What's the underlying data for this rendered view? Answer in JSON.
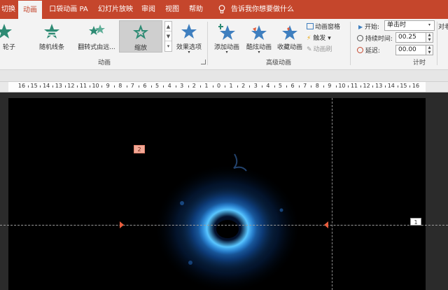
{
  "tabs": [
    {
      "label": "切换",
      "active": false
    },
    {
      "label": "动画",
      "active": true
    },
    {
      "label": "口袋动画 PA",
      "active": false
    },
    {
      "label": "幻灯片放映",
      "active": false
    },
    {
      "label": "审阅",
      "active": false
    },
    {
      "label": "视图",
      "active": false
    },
    {
      "label": "帮助",
      "active": false
    }
  ],
  "tell_me": "告诉我你想要做什么",
  "animation_gallery": [
    {
      "label": "轮子",
      "icon": "star-wheel-icon",
      "selected": false
    },
    {
      "label": "随机线条",
      "icon": "star-random-lines-icon",
      "selected": false
    },
    {
      "label": "翻转式由远...",
      "icon": "star-flip-icon",
      "selected": false
    },
    {
      "label": "缩放",
      "icon": "star-zoom-icon",
      "selected": true
    }
  ],
  "effect_options": "效果选项",
  "group_labels": {
    "animation": "动画",
    "advanced": "高级动画",
    "timing": "计时"
  },
  "advanced": {
    "add_animation": "添加动画",
    "cool_animation": "酷炫动画",
    "favorite_animation": "收藏动画",
    "animation_pane": "动画窗格",
    "trigger": "触发",
    "animation_painter": "动画刷"
  },
  "timing": {
    "start_label": "开始:",
    "start_value": "单击时",
    "duration_label": "持续时间:",
    "duration_value": "00.25",
    "delay_label": "延迟:",
    "delay_value": "00.00",
    "reorder": "对老"
  },
  "ruler_labels": [
    "16",
    "15",
    "14",
    "13",
    "12",
    "11",
    "10",
    "9",
    "8",
    "7",
    "6",
    "5",
    "4",
    "3",
    "2",
    "1",
    "0",
    "1",
    "2",
    "3",
    "4",
    "5",
    "6",
    "7",
    "8",
    "9",
    "10",
    "11",
    "12",
    "13",
    "14",
    "15",
    "16"
  ],
  "slide_tags": {
    "tag_left": "2",
    "tag_right": "1"
  },
  "colors": {
    "accent": "#c5462c",
    "ribbon": "#f3f3f3",
    "star": "#3f7fbf",
    "star_green": "#2e8b74",
    "marker": "#e85d3d",
    "glow": "#3aa8ff"
  }
}
